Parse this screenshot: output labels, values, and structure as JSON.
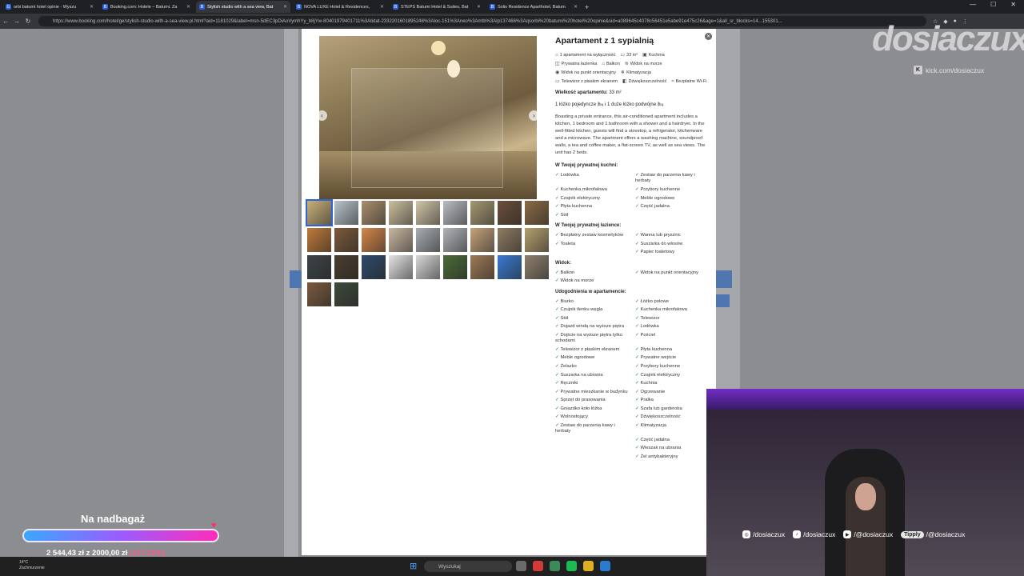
{
  "browser": {
    "tabs": [
      {
        "label": "orbi batumi hotel opinie - Wyszu",
        "active": false
      },
      {
        "label": "Booking.com: Hotele – Batumi. Za",
        "active": false
      },
      {
        "label": "Stylish studio with a sea view, Bat",
        "active": true
      },
      {
        "label": "NOVA LUXE Hotel & Residences,",
        "active": false
      },
      {
        "label": "STEPS Batumi Hotel & Suites, Bat",
        "active": false
      },
      {
        "label": "Solis Residence Aparthotel, Batum",
        "active": false
      }
    ],
    "url": "https://www.booking.com/hotel/ge/stylish-studio-with-a-sea-view.pl.html?aid=1181029&label=msn-5dEC3pDiAoVymhYy_b8jYw-80401979401711%3Atidat-2332201601895248%3Aloc-151%3Aneo%3Amtb%3Alp137466%3Aqsorbi%20batumi%20hotel%20opinie&sid=a089645c4078c56451e5abe91e475c26&age=1&all_sr_blocks=14...155301..."
  },
  "modal": {
    "title": "Apartament z 1 sypialnią",
    "features": [
      {
        "icon": "apartment-icon",
        "label": "1 apartament na wyłączność"
      },
      {
        "icon": "size-icon",
        "label": "33 m²"
      },
      {
        "icon": "kitchen-icon",
        "label": "Kuchnia"
      },
      {
        "icon": "bathroom-icon",
        "label": "Prywatna łazienka"
      },
      {
        "icon": "balcony-icon",
        "label": "Balkon"
      },
      {
        "icon": "sea-view-icon",
        "label": "Widok na morze"
      },
      {
        "icon": "landmark-icon",
        "label": "Widok na punkt orientacyjny"
      },
      {
        "icon": "ac-icon",
        "label": "Klimatyzacja"
      },
      {
        "icon": "tv-icon",
        "label": "Telewizor z płaskim ekranem"
      },
      {
        "icon": "soundproof-icon",
        "label": "Dźwiękoszczelność"
      },
      {
        "icon": "wifi-icon",
        "label": "Bezpłatne Wi-Fi"
      }
    ],
    "size_label": "Wielkość apartamentu:",
    "size_value": "33 m²",
    "beds": "1 łóżko pojedyncze 🛏 i 1 duże łóżko podwójne 🛏",
    "description": "Boasting a private entrance, this air-conditioned apartment includes a kitchen, 1 bedroom and 1 bathroom with a shower and a hairdryer. In the well-fitted kitchen, guests will find a stovetop, a refrigerator, kitchenware and a microwave. The apartment offers a washing machine, soundproof walls, a tea and coffee maker, a flat-screen TV, as well as sea views. The unit has 2 beds.",
    "sections": [
      {
        "title": "W Twojej prywatnej kuchni:",
        "items": [
          "Lodówka",
          "Zestaw do parzenia kawy i herbaty",
          "Kuchenka mikrofalowa",
          "Przybory kuchenne",
          "Czajnik elektryczny",
          "Meble ogrodowe",
          "Płyta kuchenna",
          "Część jadalna",
          "Stół"
        ]
      },
      {
        "title": "W Twojej prywatnej łazience:",
        "items": [
          "Bezpłatny zestaw kosmetyków",
          "Wanna lub prysznic",
          "Toaleta",
          "Suszarka do włosów",
          "",
          "Papier toaletowy"
        ]
      },
      {
        "title": "Widok:",
        "items": [
          "Balkon",
          "Widok na punkt orientacyjny",
          "Widok na morze"
        ]
      },
      {
        "title": "Udogodnienia w apartamencie:",
        "items": [
          "Biurko",
          "Łóżko polowe",
          "Czujnik tlenku węgla",
          "Kuchenka mikrofalowa",
          "Stół",
          "Telewizor",
          "Dojazd windą na wyższe piętra",
          "Lodówka",
          "Dojście na wyższe piętra tylko schodami",
          "Pościel",
          "Telewizor z płaskim ekranem",
          "Płyta kuchenna",
          "Meble ogrodowe",
          "Prywatne wejście",
          "Żelazko",
          "Przybory kuchenne",
          "Suszarka na ubrania",
          "Czajnik elektryczny",
          "Ręczniki",
          "Kuchnia",
          "Prywatne mieszkanie w budynku",
          "Ogrzewanie",
          "Sprzęt do prasowania",
          "Pralka",
          "Gniazdko koło łóżka",
          "Szafa lub garderoba",
          "Wolnostojący",
          "Dźwiękoszczelność",
          "Zestaw do parzenia kawy i herbaty",
          "Klimatyzacja",
          "",
          "Część jadalna",
          "",
          "Wieszak na ubrania",
          "",
          "Żel antybakteryjny"
        ]
      }
    ],
    "thumb_colors": [
      "#c9b07a",
      "#b8c4cc",
      "#a98f6e",
      "#cdbf9f",
      "#d2c6a8",
      "#b9bdc1",
      "#a59872",
      "#6b4f3a",
      "#8a6a45",
      "#c07a3a",
      "#7a5a3a",
      "#d5874a",
      "#c9b7a2",
      "#a8adb2",
      "#b0b4b8",
      "#c4a27a",
      "#8f7b62",
      "#b5a06e",
      "#3d4448",
      "#4a3e2e",
      "#2f4a6a",
      "#e4e4e4",
      "#d8d8d8",
      "#4d6b3a",
      "#9c7a56",
      "#3a7ad0",
      "#8e8070",
      "#7a5a3e",
      "#3e4a3a"
    ]
  },
  "stream": {
    "goal_title": "Na nadbagaż",
    "goal_amount": "2 544,43 zł z 2000,00 zł",
    "goal_percent": "(127,22%)",
    "goal_fraction": 1.0,
    "brand": "dosiaczux",
    "kick_url": "kick.com/dosiaczux",
    "socials": [
      {
        "icon": "instagram-icon",
        "label": "/dosiaczux"
      },
      {
        "icon": "tiktok-icon",
        "label": "/dosiaczux"
      },
      {
        "icon": "youtube-icon",
        "label": "/@dosiaczux"
      },
      {
        "icon": "tipply-icon",
        "label": "/@dosiaczux",
        "badge": "Tipply"
      }
    ]
  },
  "taskbar": {
    "weather_temp": "14°C",
    "weather_desc": "Zachmurzenie",
    "search_placeholder": "Wyszukaj"
  },
  "colors": {
    "accent": "#2b65d9",
    "check": "#2d8a3e",
    "goal_pct": "#ff5a86"
  }
}
